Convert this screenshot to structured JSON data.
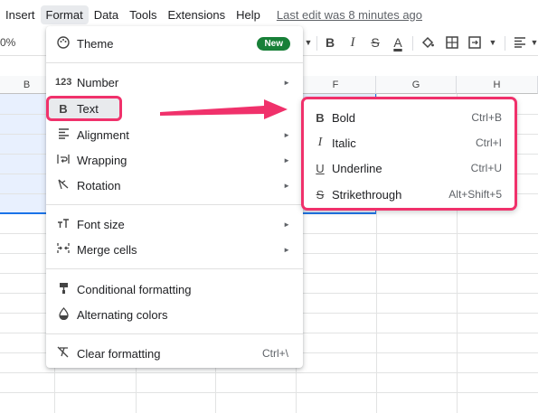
{
  "menubar": {
    "items": [
      "Insert",
      "Format",
      "Data",
      "Tools",
      "Extensions",
      "Help"
    ],
    "last_edit": "Last edit was 8 minutes ago"
  },
  "toolbar": {
    "zoom_fragment": "0%",
    "bold_label": "B",
    "italic_label": "I",
    "strike_label": "S",
    "textcolor_label": "A"
  },
  "columns": [
    "B",
    "F",
    "G",
    "H"
  ],
  "format_menu": {
    "theme": {
      "label": "Theme",
      "badge": "New"
    },
    "number": {
      "icon": "123",
      "label": "Number"
    },
    "text": {
      "icon": "B",
      "label": "Text"
    },
    "alignment": {
      "label": "Alignment"
    },
    "wrapping": {
      "label": "Wrapping"
    },
    "rotation": {
      "label": "Rotation"
    },
    "font_size": {
      "label": "Font size"
    },
    "merge_cells": {
      "label": "Merge cells"
    },
    "conditional": {
      "label": "Conditional formatting"
    },
    "alternating": {
      "label": "Alternating colors"
    },
    "clear": {
      "label": "Clear formatting",
      "shortcut": "Ctrl+\\"
    }
  },
  "text_submenu": [
    {
      "icon": "B",
      "label": "Bold",
      "shortcut": "Ctrl+B"
    },
    {
      "icon": "I",
      "label": "Italic",
      "shortcut": "Ctrl+I"
    },
    {
      "icon": "U",
      "label": "Underline",
      "shortcut": "Ctrl+U"
    },
    {
      "icon": "S",
      "label": "Strikethrough",
      "shortcut": "Alt+Shift+5"
    }
  ],
  "colors": {
    "highlight": "#f0316b",
    "new_badge": "#188038",
    "selection": "#e8f0fe"
  }
}
